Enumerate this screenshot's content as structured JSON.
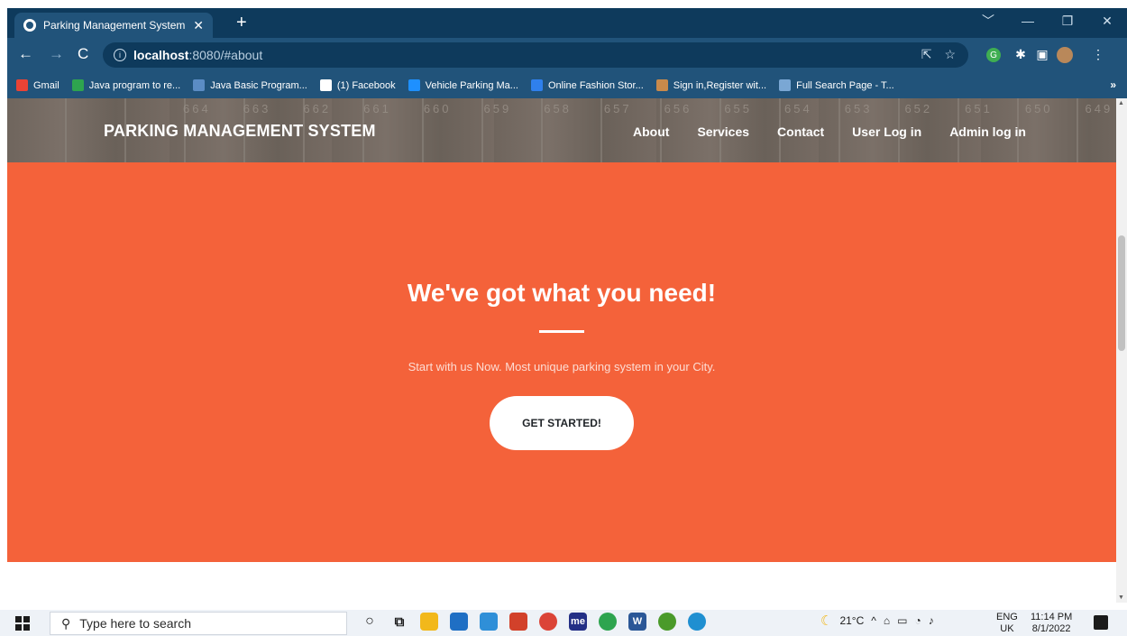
{
  "browser": {
    "tab_title": "Parking Management System Lar",
    "tab_close": "✕",
    "new_tab": "+",
    "window_controls": [
      "﹀",
      "—",
      "❐",
      "✕"
    ],
    "url_host": "localhost",
    "url_rest": ":8080/#about",
    "bookmarks": [
      {
        "label": "Gmail",
        "icon": "gmail-icon",
        "color": "#ea4335"
      },
      {
        "label": "Java program to re...",
        "icon": "java-b-icon",
        "color": "#2ea44f"
      },
      {
        "label": "Java Basic Program...",
        "icon": "w3-icon",
        "color": "#5b8cc4"
      },
      {
        "label": "(1) Facebook",
        "icon": "globe-icon",
        "color": "#ffffff"
      },
      {
        "label": "Vehicle Parking Ma...",
        "icon": "drop-icon",
        "color": "#1e90ff"
      },
      {
        "label": "Online Fashion Stor...",
        "icon": "flag-icon",
        "color": "#2f80ed"
      },
      {
        "label": "Sign in,Register wit...",
        "icon": "hand-icon",
        "color": "#c98a4b"
      },
      {
        "label": "Full Search Page - T...",
        "icon": "t-icon",
        "color": "#7aa7d4"
      }
    ],
    "bookmarks_more": "»"
  },
  "site": {
    "brand": "PARKING MANAGEMENT SYSTEM",
    "nav": [
      "About",
      "Services",
      "Contact",
      "User Log in",
      "Admin log in"
    ],
    "slot_numbers": [
      "664",
      "663",
      "662",
      "661",
      "660",
      "659",
      "658",
      "657",
      "656",
      "655",
      "654",
      "653",
      "652",
      "651",
      "650",
      "649"
    ],
    "hero_title": "We've got what you need!",
    "hero_subtitle": "Start with us Now. Most unique parking system in your City.",
    "cta_label": "GET STARTED!",
    "accent_color": "#f4623a"
  },
  "taskbar": {
    "search_placeholder": "Type here to search",
    "weather": "21°C",
    "lang_top": "ENG",
    "lang_bottom": "UK",
    "time": "11:14 PM",
    "date": "8/1/2022"
  }
}
